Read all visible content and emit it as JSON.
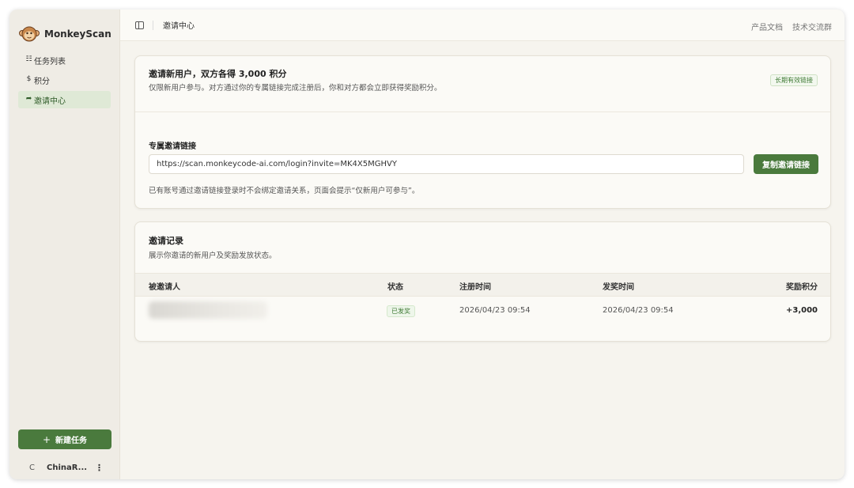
{
  "app": {
    "name": "MonkeyScan"
  },
  "colors": {
    "accent": "#4a7a3d",
    "active_bg": "#dfe9d6"
  },
  "sidebar": {
    "items": [
      {
        "label": "任务列表",
        "icon": "list-icon"
      },
      {
        "label": "积分",
        "icon": "coin-icon"
      },
      {
        "label": "邀请中心",
        "icon": "share-icon",
        "active": true
      }
    ],
    "new_task_label": "新建任务",
    "user": {
      "avatar_letter": "C",
      "name": "ChinaR..."
    }
  },
  "topbar": {
    "breadcrumb": "邀请中心",
    "links": [
      "产品文档",
      "技术交流群"
    ]
  },
  "invite_card": {
    "title": "邀请新用户，双方各得 3,000 积分",
    "description": "仅限新用户参与。对方通过你的专属链接完成注册后，你和对方都会立即获得奖励积分。",
    "badge": "长期有效链接",
    "link_label": "专属邀请链接",
    "link_value": "https://scan.monkeycode-ai.com/login?invite=MK4X5MGHVY",
    "copy_button": "复制邀请链接",
    "note": "已有账号通过邀请链接登录时不会绑定邀请关系，页面会提示“仅新用户可参与”。"
  },
  "records_card": {
    "title": "邀请记录",
    "description": "展示你邀请的新用户及奖励发放状态。",
    "columns": [
      "被邀请人",
      "状态",
      "注册时间",
      "发奖时间",
      "奖励积分"
    ],
    "rows": [
      {
        "invitee": "",
        "status": "已发奖",
        "registered": "2026/04/23 09:54",
        "rewarded": "2026/04/23 09:54",
        "points": "+3,000"
      }
    ]
  }
}
